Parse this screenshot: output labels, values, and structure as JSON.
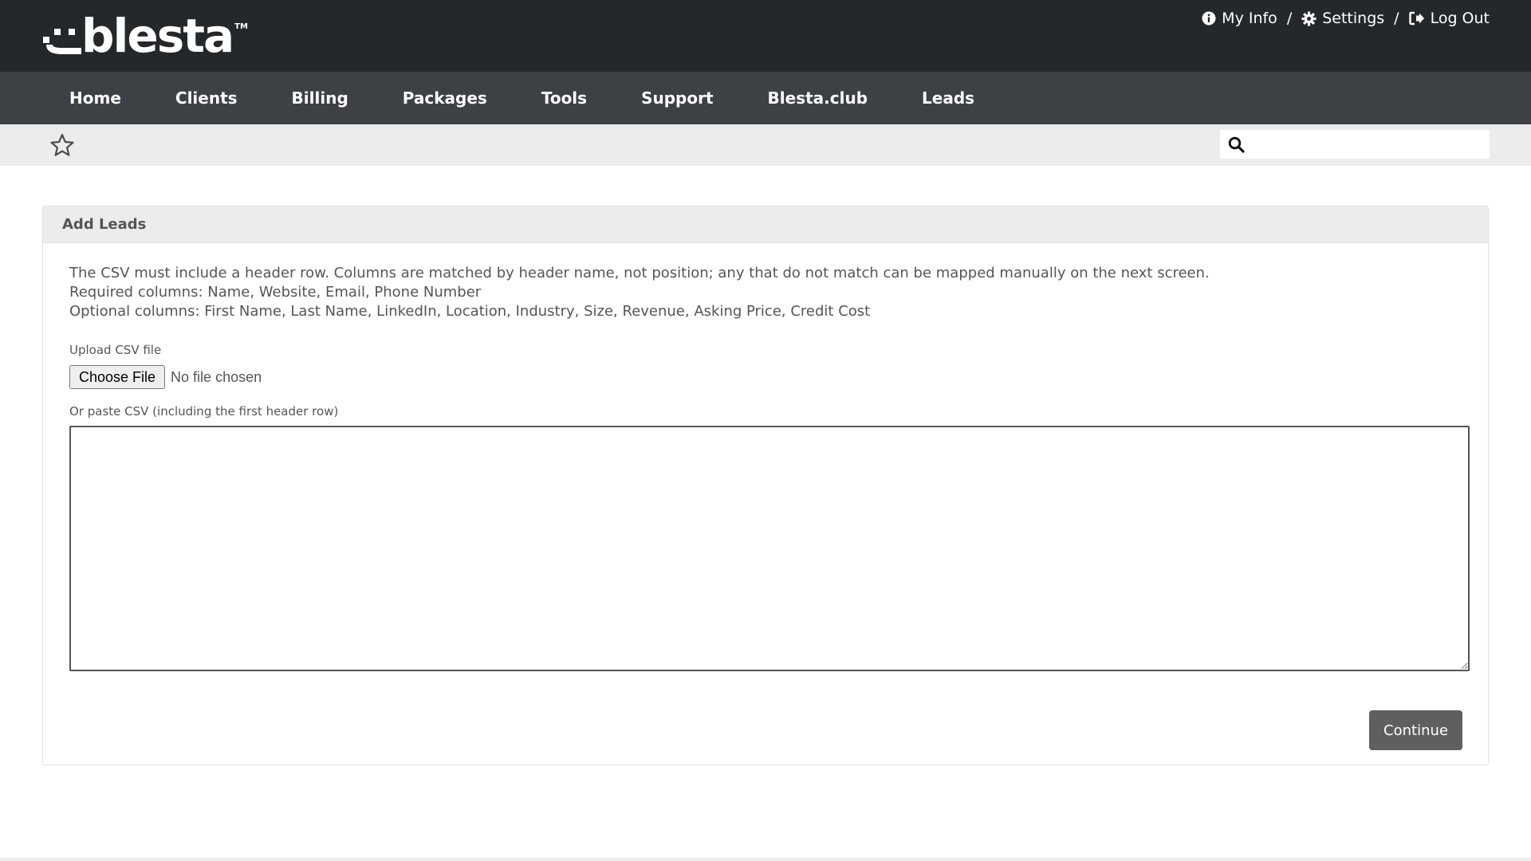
{
  "header": {
    "logo_text": "blesta",
    "logo_tm": "TM",
    "user_links": [
      {
        "label": "My Info",
        "icon": "info-icon"
      },
      {
        "label": "Settings",
        "icon": "gear-icon"
      },
      {
        "label": "Log Out",
        "icon": "logout-icon"
      }
    ],
    "separator": "/"
  },
  "nav": {
    "items": [
      "Home",
      "Clients",
      "Billing",
      "Packages",
      "Tools",
      "Support",
      "Blesta.club",
      "Leads"
    ]
  },
  "subbar": {
    "star_icon": "star-icon",
    "search_icon": "search-icon",
    "search_value": ""
  },
  "panel": {
    "title": "Add Leads",
    "description": [
      "The CSV must include a header row. Columns are matched by header name, not position; any that do not match can be mapped manually on the next screen.",
      "Required columns: Name, Website, Email, Phone Number",
      "Optional columns: First Name, Last Name, LinkedIn, Location, Industry, Size, Revenue, Asking Price, Credit Cost"
    ],
    "upload_label": "Upload CSV file",
    "choose_file_label": "Choose File",
    "no_file_text": "No file chosen",
    "paste_label": "Or paste CSV (including the first header row)",
    "paste_value": "",
    "continue_label": "Continue"
  },
  "colors": {
    "topbar": "#25282b",
    "navbar": "#3d4145",
    "subbar": "#ececec",
    "button": "#5f5f5f"
  }
}
